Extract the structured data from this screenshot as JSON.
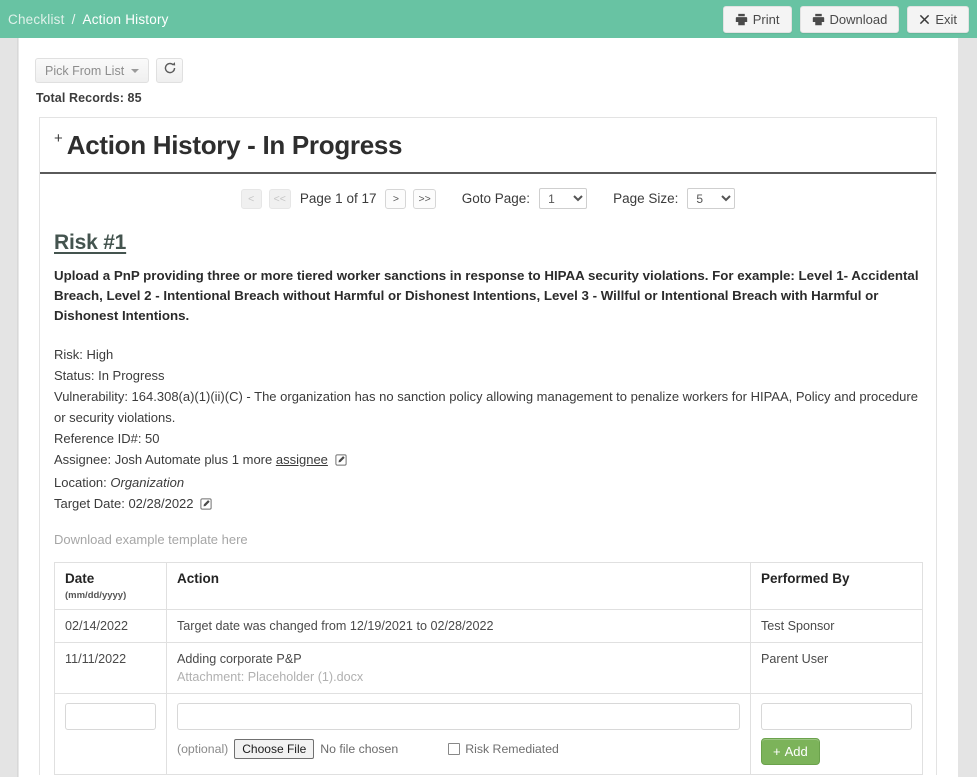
{
  "breadcrumb": {
    "parent": "Checklist",
    "separator": "/",
    "current": "Action History"
  },
  "topbar": {
    "print_label": "Print",
    "download_label": "Download",
    "exit_label": "Exit",
    "bar_color": "#68c3a3"
  },
  "toolbar": {
    "pick_list_label": "Pick From List",
    "refresh_icon": "refresh-icon",
    "total_records": "Total Records: 85"
  },
  "card": {
    "expand_toggle": "+",
    "title": "Action History - In Progress"
  },
  "pager": {
    "first_label": "<",
    "prev_label": "<<",
    "page_label": "Page 1 of 17",
    "next_label": ">",
    "last_label": ">>",
    "goto_label": "Goto Page:",
    "goto_value": "1",
    "size_label": "Page Size:",
    "size_value": "5"
  },
  "risk": {
    "title": "Risk #1",
    "description": "Upload a PnP providing three or more tiered worker sanctions in response to HIPAA security violations. For example: Level 1- Accidental Breach, Level 2 - Intentional Breach without Harmful or Dishonest Intentions, Level 3 - Willful or Intentional Breach with Harmful or Dishonest Intentions.",
    "risk_line": "Risk: High",
    "status_line": "Status: In Progress",
    "vulnerability_line": "Vulnerability: 164.308(a)(1)(ii)(C) - The organization has no sanction policy allowing management to penalize workers for HIPAA, Policy and procedure or security violations.",
    "reference_line": "Reference ID#: 50",
    "assignee_prefix": "Assignee: Josh Automate plus 1 more",
    "assignee_link": "assignee",
    "location_label": "Location:",
    "location_value": "Organization",
    "target_date_label": "Target Date:",
    "target_date_value": "02/28/2022",
    "template_link": "Download example template here"
  },
  "table": {
    "headers": {
      "date": "Date",
      "date_hint": "(mm/dd/yyyy)",
      "action": "Action",
      "performed_by": "Performed By"
    },
    "rows": [
      {
        "date": "02/14/2022",
        "action": "Target date was changed from 12/19/2021 to 02/28/2022",
        "attachment": "",
        "performed_by": "Test Sponsor"
      },
      {
        "date": "11/11/2022",
        "action": "Adding corporate P&P",
        "attachment": "Attachment: Placeholder (1).docx",
        "performed_by": "Parent User"
      }
    ],
    "new_row": {
      "date_value": "",
      "action_value": "",
      "performed_by_value": "",
      "optional_label": "(optional)",
      "choose_file_label": "Choose File",
      "no_file_label": "No file chosen",
      "remediated_label": "Risk Remediated",
      "remediated_checked": false,
      "add_label": "Add",
      "add_plus": "+",
      "add_color": "#7cb35a"
    }
  }
}
